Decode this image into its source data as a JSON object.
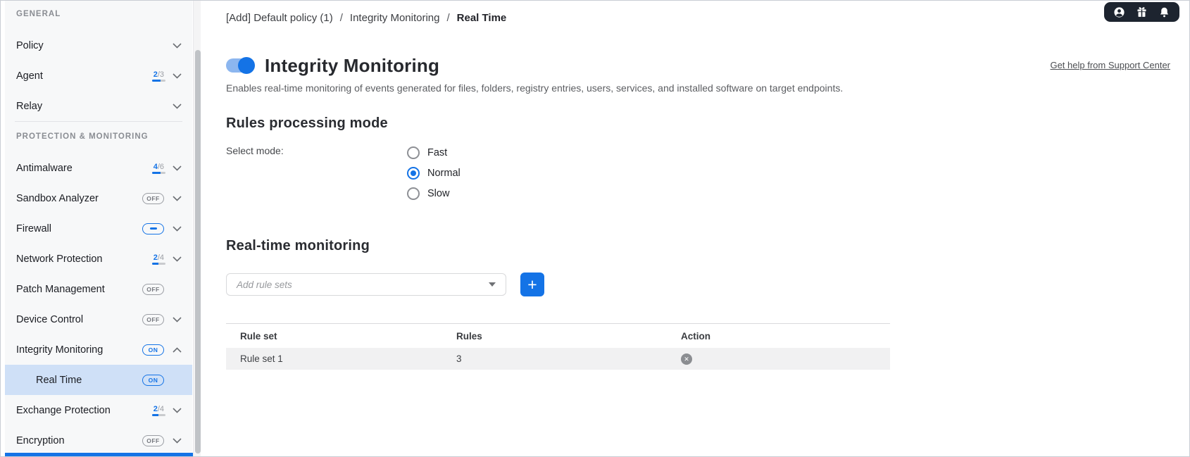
{
  "colors": {
    "accent": "#1473e6",
    "sidebar_bg": "#f7f8f9",
    "selected_row": "#cfe0f7",
    "corner_badge_bg": "#1d242f",
    "table_row_bg": "#f1f1f2"
  },
  "sidebar": {
    "sections": [
      {
        "label": "GENERAL",
        "items": [
          {
            "label": "Policy"
          },
          {
            "label": "Agent",
            "badge": {
              "type": "progress",
              "done": "2",
              "total": "/3"
            }
          },
          {
            "label": "Relay"
          }
        ]
      },
      {
        "label": "PROTECTION & MONITORING",
        "items": [
          {
            "label": "Antimalware",
            "badge": {
              "type": "progress",
              "done": "4",
              "total": "/6"
            }
          },
          {
            "label": "Sandbox Analyzer",
            "badge": {
              "type": "pill",
              "text": "OFF"
            }
          },
          {
            "label": "Firewall",
            "badge": {
              "type": "pill-partial"
            }
          },
          {
            "label": "Network Protection",
            "badge": {
              "type": "progress",
              "done": "2",
              "total": "/4"
            }
          },
          {
            "label": "Patch Management",
            "badge": {
              "type": "pill",
              "text": "OFF"
            }
          },
          {
            "label": "Device Control",
            "badge": {
              "type": "pill",
              "text": "OFF"
            }
          },
          {
            "label": "Integrity Monitoring",
            "badge": {
              "type": "pill-on",
              "text": "ON"
            }
          },
          {
            "label": "Real Time",
            "badge": {
              "type": "pill-on",
              "text": "ON"
            }
          },
          {
            "label": "Exchange Protection",
            "badge": {
              "type": "progress",
              "done": "2",
              "total": "/4"
            }
          },
          {
            "label": "Encryption",
            "badge": {
              "type": "pill",
              "text": "OFF"
            }
          }
        ]
      }
    ]
  },
  "header": {
    "breadcrumb": [
      "[Add] Default policy (1)",
      "Integrity Monitoring",
      "Real Time"
    ],
    "separator": "/",
    "corner_icons": [
      "user-icon",
      "gift-icon",
      "bell-icon"
    ],
    "help_link": "Get help from Support Center"
  },
  "main": {
    "title": "Integrity Monitoring",
    "toggle_state": "on",
    "description": "Enables real-time monitoring of events generated for files, folders, registry entries, users, services, and installed software on target endpoints.",
    "rules_mode": {
      "heading": "Rules processing mode",
      "label": "Select mode:",
      "options": [
        {
          "label": "Fast",
          "selected": false
        },
        {
          "label": "Normal",
          "selected": true
        },
        {
          "label": "Slow",
          "selected": false
        }
      ]
    },
    "realtime": {
      "heading": "Real-time monitoring",
      "dropdown_placeholder": "Add rule sets",
      "add_button": "+",
      "remove_icon": "✕",
      "table": {
        "columns": [
          "Rule set",
          "Rules",
          "Action"
        ],
        "rows": [
          {
            "rule_set": "Rule set 1",
            "rules": "3"
          }
        ]
      }
    }
  }
}
